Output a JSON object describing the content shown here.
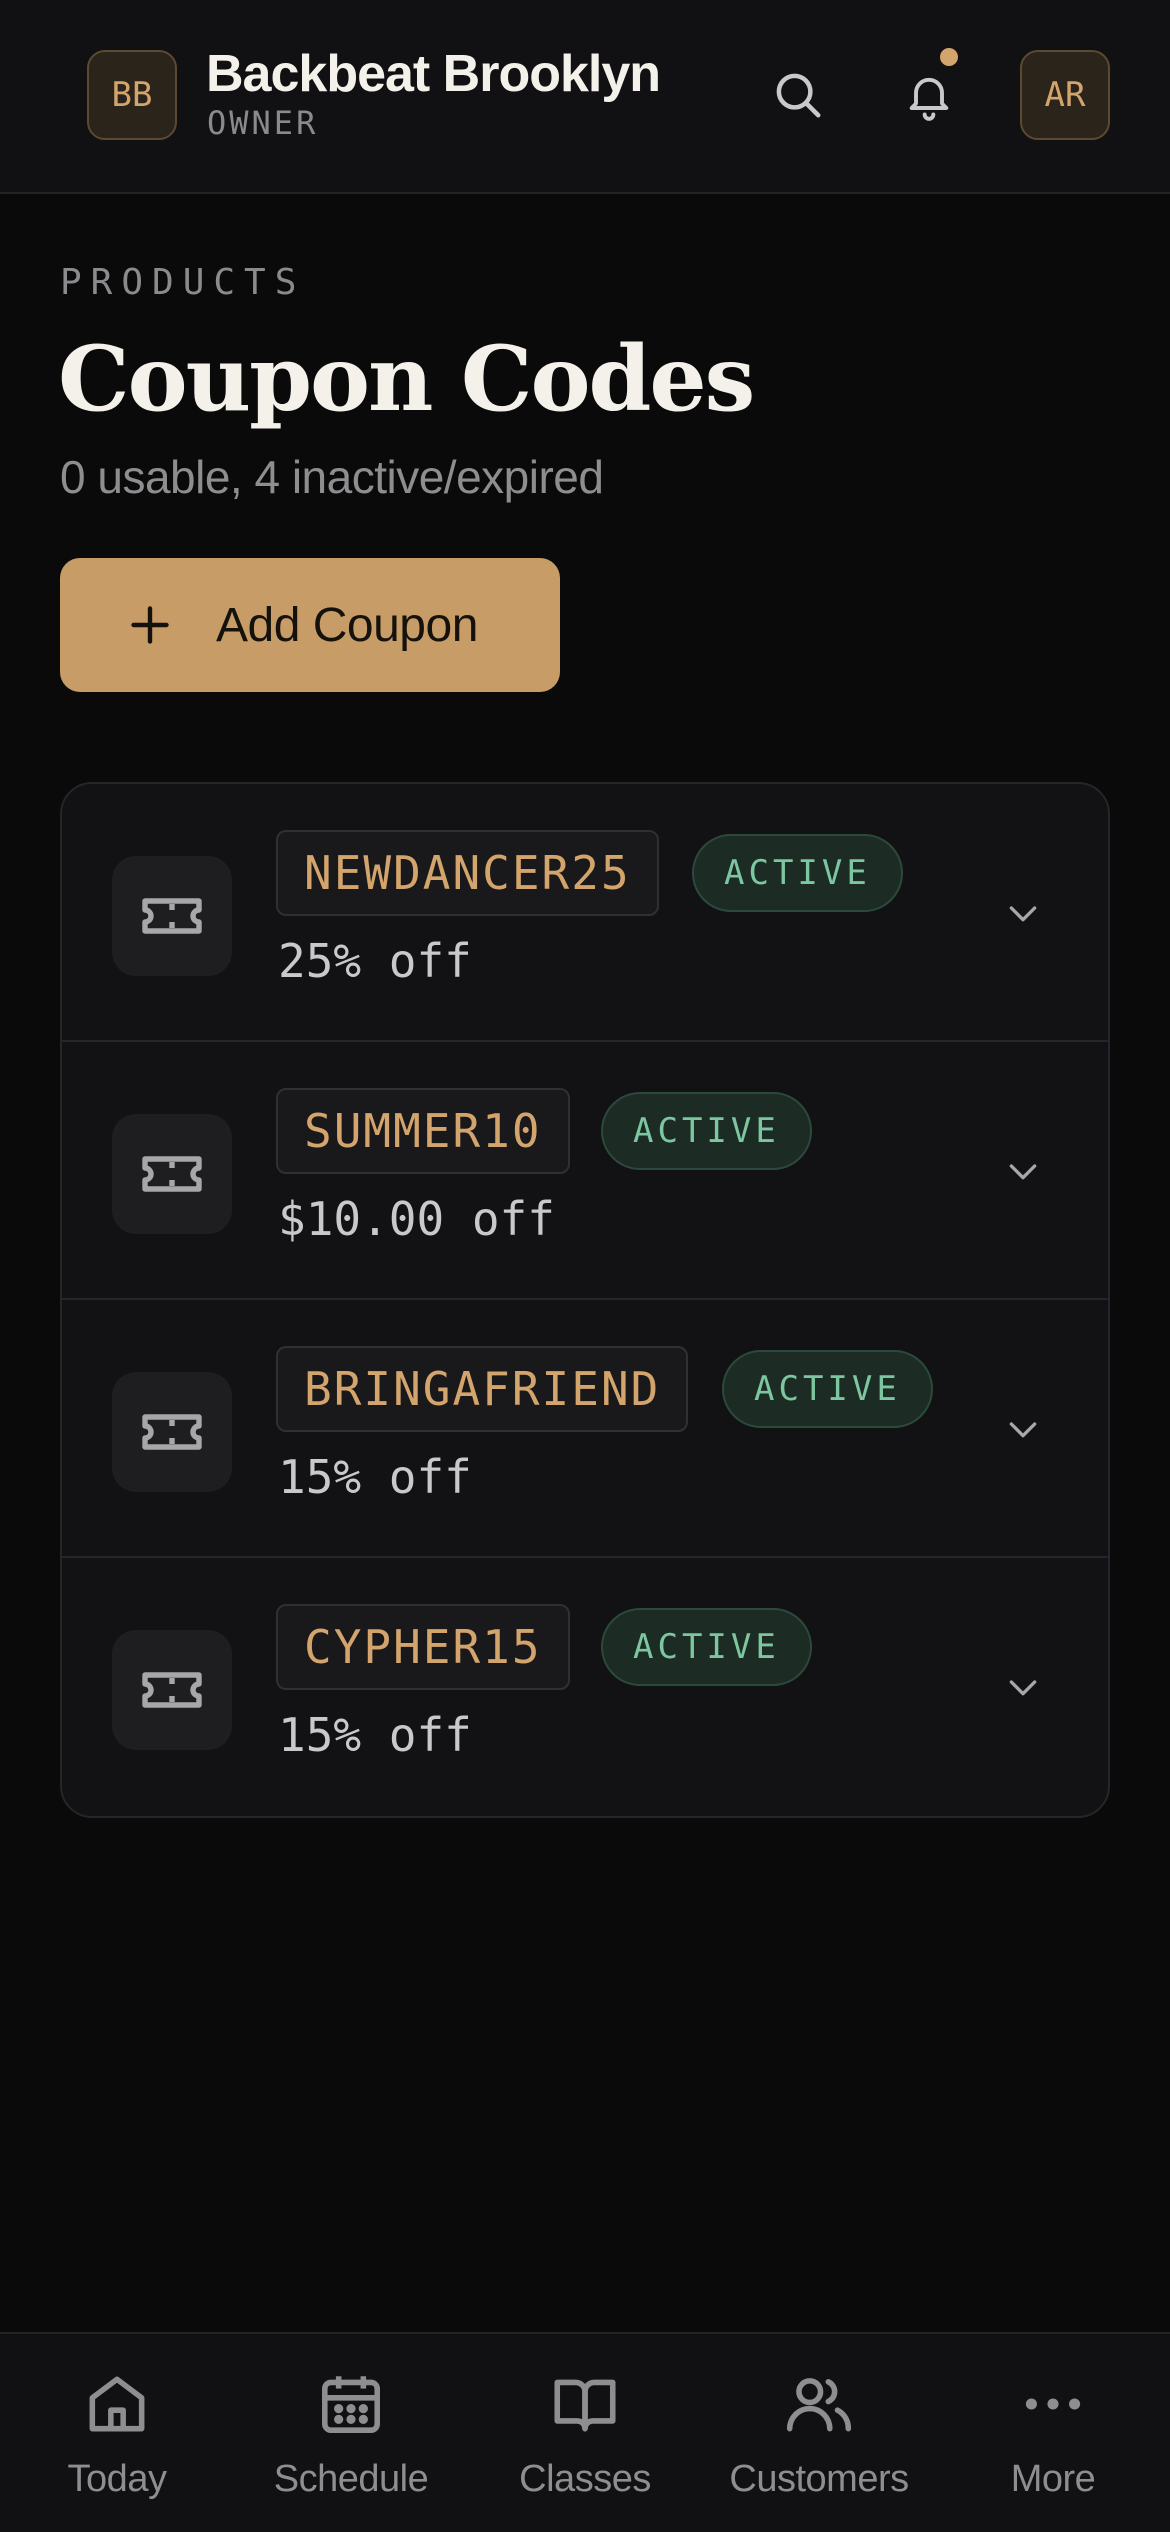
{
  "header": {
    "studio_initials": "BB",
    "studio_name": "Backbeat Brooklyn",
    "role": "OWNER",
    "user_initials": "AR",
    "has_notification": true,
    "accent_color": "#d3a46b"
  },
  "page": {
    "eyebrow": "PRODUCTS",
    "title": "Coupon Codes",
    "subtitle": "0 usable, 4 inactive/expired",
    "add_button_label": "Add Coupon"
  },
  "coupons": [
    {
      "code": "NEWDANCER25",
      "status": "ACTIVE",
      "discount": "25% off"
    },
    {
      "code": "SUMMER10",
      "status": "ACTIVE",
      "discount": "$10.00 off"
    },
    {
      "code": "BRINGAFRIEND",
      "status": "ACTIVE",
      "discount": "15% off"
    },
    {
      "code": "CYPHER15",
      "status": "ACTIVE",
      "discount": "15% off"
    }
  ],
  "nav": {
    "items": [
      {
        "label": "Today",
        "icon": "home-icon"
      },
      {
        "label": "Schedule",
        "icon": "calendar-icon"
      },
      {
        "label": "Classes",
        "icon": "book-icon"
      },
      {
        "label": "Customers",
        "icon": "users-icon"
      },
      {
        "label": "More",
        "icon": "more-icon"
      }
    ]
  },
  "colors": {
    "background": "#0a0a0b",
    "accent": "#c89c66",
    "status_active": "#7cc79f"
  }
}
